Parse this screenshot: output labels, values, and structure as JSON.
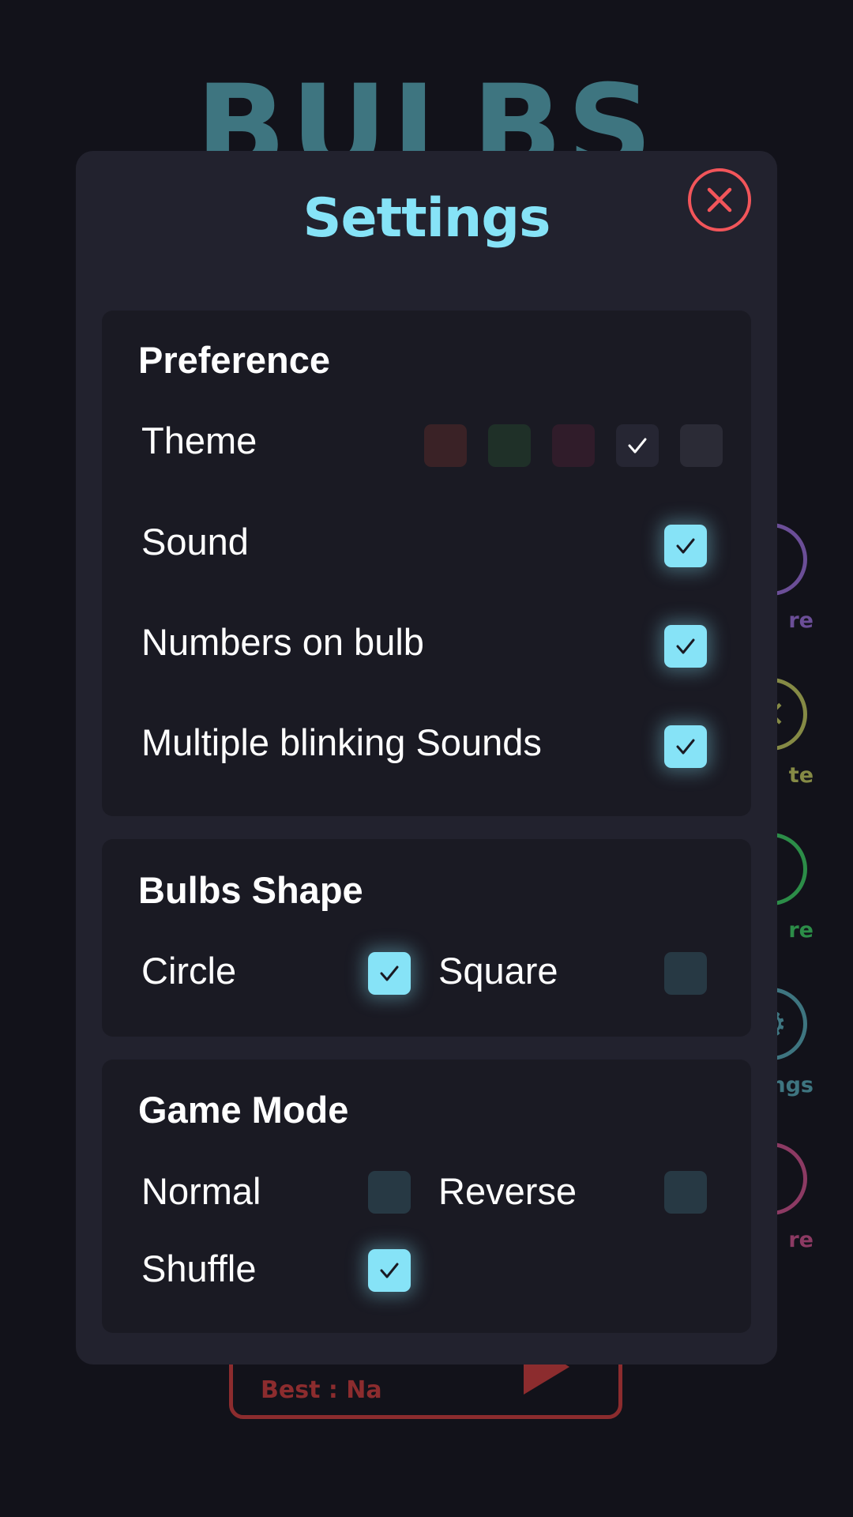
{
  "background": {
    "app_title": "BULBS",
    "side_buttons": [
      {
        "name": "share",
        "label": "re",
        "color": "#6b4e97",
        "icon": "share-icon",
        "glyph": "⁞"
      },
      {
        "name": "rate",
        "label": "te",
        "color": "#858a45",
        "icon": "star-icon",
        "glyph": "✕"
      },
      {
        "name": "more",
        "label": "re",
        "color": "#2c8d48",
        "icon": "more-icon",
        "glyph": "i"
      },
      {
        "name": "settings",
        "label": "ngs",
        "color": "#3e7580",
        "icon": "gear-icon",
        "glyph": "⚙"
      },
      {
        "name": "feedback",
        "label": "re",
        "color": "#8c3a63",
        "icon": "alert-icon",
        "glyph": "!"
      }
    ],
    "play_button": {
      "best_text": "Best : Na",
      "color": "#8c2c2e"
    }
  },
  "modal": {
    "title": "Settings",
    "preference": {
      "title": "Preference",
      "theme_label": "Theme",
      "theme_swatches": [
        {
          "color": "#3a2226",
          "selected": false
        },
        {
          "color": "#1f3028",
          "selected": false
        },
        {
          "color": "#301c2a",
          "selected": false
        },
        {
          "color": "#262633",
          "selected": true
        },
        {
          "color": "#2b2b36",
          "selected": false
        }
      ],
      "sound_label": "Sound",
      "sound_checked": true,
      "numbers_label": "Numbers on bulb",
      "numbers_checked": true,
      "multiple_label": "Multiple blinking Sounds",
      "multiple_checked": true
    },
    "bulbs_shape": {
      "title": "Bulbs Shape",
      "circle_label": "Circle",
      "circle_checked": true,
      "square_label": "Square",
      "square_checked": false
    },
    "game_mode": {
      "title": "Game Mode",
      "normal_label": "Normal",
      "normal_checked": false,
      "reverse_label": "Reverse",
      "reverse_checked": false,
      "shuffle_label": "Shuffle",
      "shuffle_checked": true
    }
  },
  "colors": {
    "accent": "#86e3f7",
    "close": "#f2555a",
    "modal_bg": "#22222e",
    "card_bg": "#1a1a23"
  }
}
